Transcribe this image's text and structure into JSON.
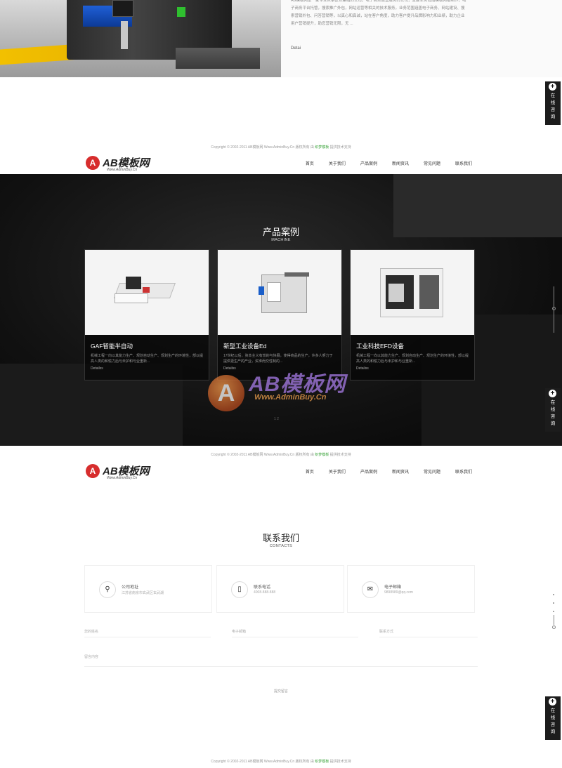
{
  "about": {
    "description": "AB模板网是一家专业从事企业建站的公司，电子商务运营服务的公司，主要业务包括模板网站制作，电子商务平台托管，搜索推广外包，网站运营等相关的技术服务，业务范围涵盖电子商务、网站建设、搜索营销外包、问答营销等，以真心和真诚，站在客户角度，助力客户提升品牌影响力和业绩，助力企业用户营销提升，助您营销无限，无 ...",
    "detail_link": "Detai"
  },
  "consult": {
    "label": "在线咨询",
    "icon": "plus-icon"
  },
  "footer": {
    "prefix": "Copyright © 2002-2011 AB模板网 Www.AdminBuy.Cn 版权所有 由 ",
    "highlight": "织梦模板",
    "suffix": " 提供技术支持"
  },
  "header": {
    "logo_mark": "A",
    "logo_text": "AB模板网",
    "logo_sub": "Www.AdminBuy.Cn",
    "nav": [
      "首页",
      "关于我们",
      "产品案例",
      "新闻资讯",
      "常见问题",
      "联系我们"
    ]
  },
  "products": {
    "title": "产品案例",
    "subtitle": "MACHINE",
    "cards": [
      {
        "title": "GAF智能半自动",
        "desc": "机械工程一向以其能力生产、规划自动生产、规划生产的环境性，部以提高人类的和愉力后与未护和与业重新...",
        "more": "Detailss"
      },
      {
        "title": "新型工业设备Ed",
        "desc": "17世纪以后，资本主义有较的与快展，使得商品的生产，许多人努力于提供更生产的产业，资准而交性制的...",
        "more": "Detailss"
      },
      {
        "title": "工业科技EFD设备",
        "desc": "机械工程一向以其能力生产、规划自动生产、规划生产的环境性，部以提高人类的和愉力后与未护和与业重新...",
        "more": "Detailss"
      }
    ],
    "pagination": "1 2"
  },
  "watermark": {
    "mark": "A",
    "text": "AB模板网",
    "sub": "Www.AdminBuy.Cn"
  },
  "contact": {
    "title": "联系我们",
    "subtitle": "CONTACTS",
    "items": [
      {
        "icon": "location-pin-icon",
        "label": "公司地址",
        "value": "江苏省南京市玄武区玄武湖"
      },
      {
        "icon": "phone-icon",
        "label": "联系电话",
        "value": "4008-888-888"
      },
      {
        "icon": "mail-icon",
        "label": "电子邮箱",
        "value": "9898989@qq.com"
      }
    ],
    "form": {
      "name_placeholder": "您的姓名",
      "email_placeholder": "电子邮箱",
      "phone_placeholder": "联系方式",
      "message_placeholder": "留言内容",
      "submit_label": "提交留言"
    }
  },
  "colors": {
    "accent_red": "#d72d2d",
    "dark_bg": "#111111",
    "link_green": "#3aa33a"
  }
}
